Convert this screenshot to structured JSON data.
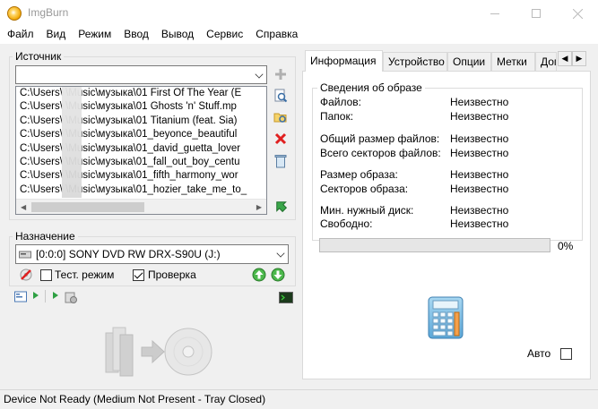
{
  "window": {
    "title": "ImgBurn"
  },
  "menu": [
    "Файл",
    "Вид",
    "Режим",
    "Ввод",
    "Вывод",
    "Сервис",
    "Справка"
  ],
  "source": {
    "label": "Источник",
    "combo_value": "",
    "files": [
      "C:\\Users\\        \\Music\\музыка\\01 First Of The Year (E",
      "C:\\Users\\        \\Music\\музыка\\01 Ghosts 'n' Stuff.mp",
      "C:\\Users\\        \\Music\\музыка\\01 Titanium (feat. Sia)",
      "C:\\Users\\        \\Music\\музыка\\01_beyonce_beautiful",
      "C:\\Users\\        \\Music\\музыка\\01_david_guetta_lover",
      "C:\\Users\\        \\Music\\музыка\\01_fall_out_boy_centu",
      "C:\\Users\\        \\Music\\музыка\\01_fifth_harmony_wor",
      "C:\\Users\\        \\Music\\музыка\\01_hozier_take_me_to_"
    ]
  },
  "destination": {
    "label": "Назначение",
    "drive": "[0:0:0] SONY DVD RW DRX-S90U (J:)",
    "test_mode_label": "Тест. режим",
    "test_mode_checked": false,
    "verify_label": "Проверка",
    "verify_checked": true
  },
  "tabs": [
    "Информация",
    "Устройство",
    "Опции",
    "Метки",
    "Дог"
  ],
  "active_tab": 0,
  "image_info": {
    "group_label": "Сведения об образе",
    "rows": [
      {
        "label": "Файлов:",
        "value": "Неизвестно"
      },
      {
        "label": "Папок:",
        "value": "Неизвестно"
      },
      {
        "label": "Общий размер файлов:",
        "value": "Неизвестно"
      },
      {
        "label": "Всего секторов файлов:",
        "value": "Неизвестно"
      },
      {
        "label": "Размер образа:",
        "value": "Неизвестно"
      },
      {
        "label": "Секторов образа:",
        "value": "Неизвестно"
      },
      {
        "label": "Мин. нужный диск:",
        "value": "Неизвестно"
      },
      {
        "label": "Свободно:",
        "value": "Неизвестно"
      }
    ]
  },
  "progress": {
    "percent_label": "0%",
    "value": 0
  },
  "auto": {
    "label": "Авто",
    "checked": false
  },
  "status": {
    "text": "Device Not Ready (Medium Not Present - Tray Closed)"
  },
  "colors": {
    "progress_fill": "#06b025",
    "accent_green": "#3aa64a",
    "delete_red": "#e02020"
  }
}
